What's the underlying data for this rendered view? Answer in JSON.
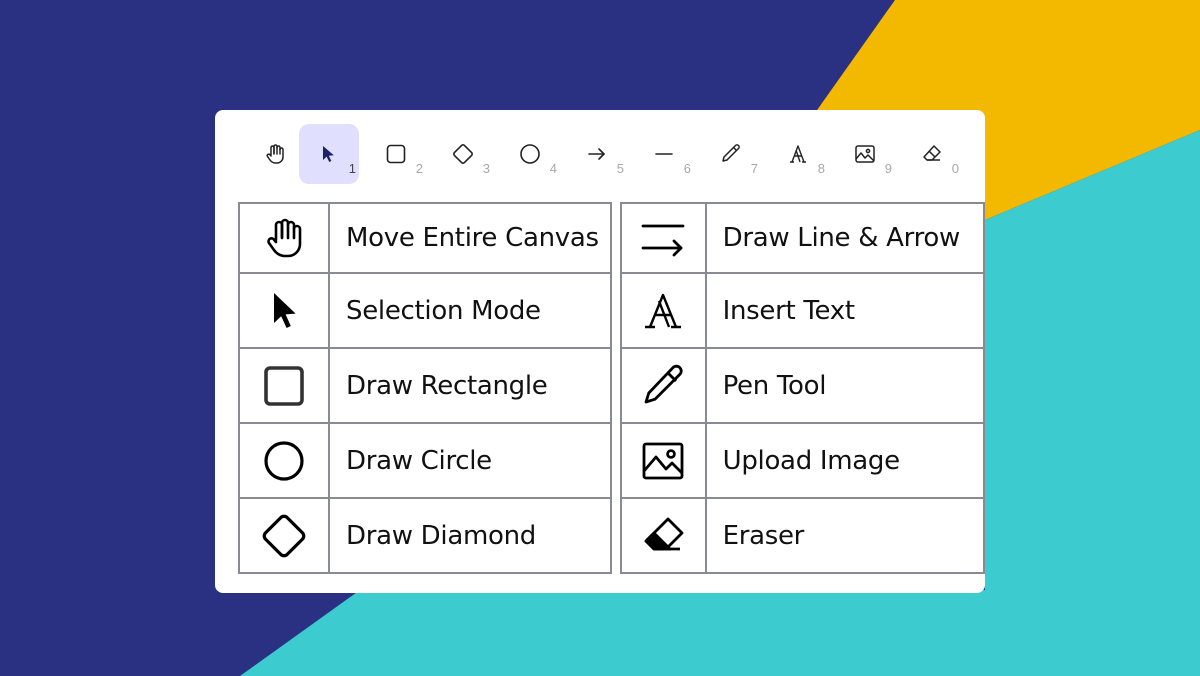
{
  "colors": {
    "background_navy": "#2b3182",
    "background_yellow": "#f3b800",
    "background_teal": "#3ccbcf",
    "active_tool": "#e0dffd"
  },
  "toolbar": {
    "tools": [
      {
        "icon": "hand-icon",
        "key": ""
      },
      {
        "icon": "cursor-icon",
        "key": "1",
        "active": true
      },
      {
        "icon": "rectangle-icon",
        "key": "2"
      },
      {
        "icon": "diamond-icon",
        "key": "3"
      },
      {
        "icon": "circle-icon",
        "key": "4"
      },
      {
        "icon": "arrow-icon",
        "key": "5"
      },
      {
        "icon": "line-icon",
        "key": "6"
      },
      {
        "icon": "pencil-icon",
        "key": "7"
      },
      {
        "icon": "text-icon",
        "key": "8"
      },
      {
        "icon": "image-icon",
        "key": "9"
      },
      {
        "icon": "eraser-icon",
        "key": "0"
      }
    ]
  },
  "legend": {
    "left": [
      {
        "icon": "hand-icon",
        "label": "Move Entire Canvas"
      },
      {
        "icon": "cursor-icon",
        "label": "Selection Mode"
      },
      {
        "icon": "rectangle-icon",
        "label": "Draw Rectangle"
      },
      {
        "icon": "circle-icon",
        "label": "Draw Circle"
      },
      {
        "icon": "diamond-icon",
        "label": "Draw Diamond"
      }
    ],
    "right": [
      {
        "icon": "line-arrow-icon",
        "label": "Draw Line & Arrow"
      },
      {
        "icon": "text-icon",
        "label": "Insert Text"
      },
      {
        "icon": "pencil-icon",
        "label": "Pen Tool"
      },
      {
        "icon": "image-icon",
        "label": "Upload Image"
      },
      {
        "icon": "eraser-icon",
        "label": "Eraser"
      }
    ]
  }
}
